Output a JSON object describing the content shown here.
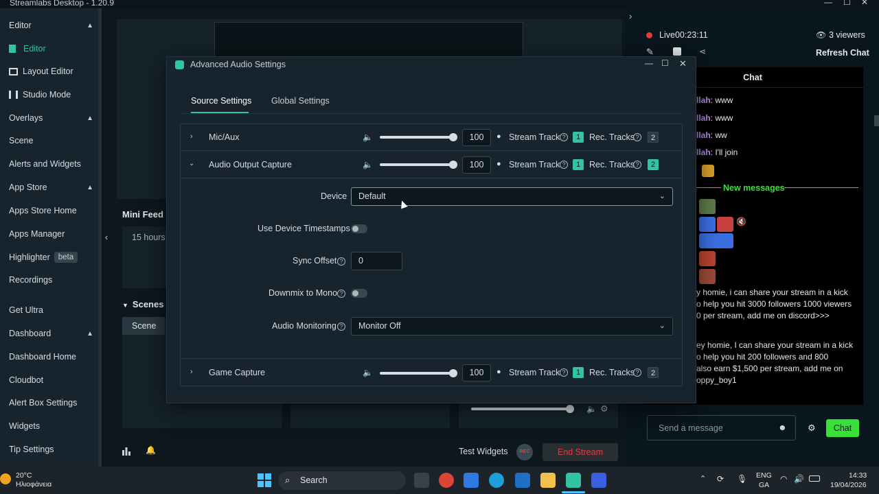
{
  "app": {
    "title": "Streamlabs Desktop - 1.20.9"
  },
  "sidebar": {
    "items": [
      {
        "label": "Editor",
        "kind": "head"
      },
      {
        "label": "Editor",
        "kind": "sub",
        "active": true
      },
      {
        "label": "Layout Editor",
        "kind": "sub"
      },
      {
        "label": "Studio Mode",
        "kind": "sub"
      },
      {
        "label": "Overlays",
        "kind": "head"
      },
      {
        "label": "Scene",
        "kind": "sub"
      },
      {
        "label": "Alerts and Widgets",
        "kind": "sub"
      },
      {
        "label": "App Store",
        "kind": "head"
      },
      {
        "label": "Apps Store Home",
        "kind": "sub"
      },
      {
        "label": "Apps Manager",
        "kind": "sub"
      },
      {
        "label": "Highlighter",
        "kind": "head",
        "badge": "beta"
      },
      {
        "label": "Recordings",
        "kind": "sub"
      },
      {
        "label": "Get Ultra",
        "kind": "head"
      },
      {
        "label": "Dashboard",
        "kind": "head"
      },
      {
        "label": "Dashboard Home",
        "kind": "sub"
      },
      {
        "label": "Cloudbot",
        "kind": "sub"
      },
      {
        "label": "Alert Box Settings",
        "kind": "sub"
      },
      {
        "label": "Widgets",
        "kind": "sub"
      },
      {
        "label": "Tip Settings",
        "kind": "sub"
      }
    ]
  },
  "main": {
    "mini_feed": "Mini Feed",
    "mini_feed_time": "15 hours",
    "scenes": "Scenes",
    "scene_item": "Scene",
    "test_widgets": "Test Widgets",
    "rec": "REC",
    "end_stream": "End Stream"
  },
  "chat": {
    "live": "Live",
    "timer": "00:23:11",
    "viewers": "3 viewers",
    "refresh": "Refresh Chat",
    "title": "Chat",
    "lines": [
      {
        "user": "llah",
        "text": ": www"
      },
      {
        "user": "llah",
        "text": ": www"
      },
      {
        "user": "llah",
        "text": ": ww"
      },
      {
        "user": "llah",
        "text": ": I'll join"
      }
    ],
    "new_messages": "New messages",
    "spam1": [
      "y homie, i can share your stream in a kick",
      "o help you hit 3000 followers 1000 viewers",
      "0 per stream, add me on discord>>>"
    ],
    "spam2": [
      "ey homie, I can share your stream in a kick",
      "o help you hit 200 followers and 800",
      "also earn $1,500 per stream, add me on",
      "oppy_boy1"
    ],
    "input_placeholder": "Send a message",
    "send": "Chat"
  },
  "dialog": {
    "title": "Advanced Audio Settings",
    "tabs": [
      "Source Settings",
      "Global Settings"
    ],
    "sources": [
      {
        "name": "Mic/Aux",
        "volume": "100",
        "level": 0.97,
        "stream_track": "Stream Track",
        "stream_badge": "1",
        "rec_tracks": "Rec. Tracks",
        "rec_badge": "2",
        "rec_on": false
      },
      {
        "name": "Audio Output Capture",
        "volume": "100",
        "level": 0.97,
        "stream_track": "Stream Track",
        "stream_badge": "1",
        "rec_tracks": "Rec. Tracks",
        "rec_badge": "2",
        "rec_on": true
      },
      {
        "name": "Game Capture",
        "volume": "100",
        "level": 0.97,
        "stream_track": "Stream Track",
        "stream_badge": "1",
        "rec_tracks": "Rec. Tracks",
        "rec_badge": "2",
        "rec_on": false
      }
    ],
    "device_label": "Device",
    "device_value": "Default",
    "timestamps_label": "Use Device Timestamps",
    "sync_label": "Sync Offset",
    "sync_value": "0",
    "downmix_label": "Downmix to Mono",
    "monitoring_label": "Audio Monitoring",
    "monitoring_value": "Monitor Off"
  },
  "taskbar": {
    "temp": "20°C",
    "weather": "Ηλιοφάνεια",
    "search": "Search",
    "lang1": "ENG",
    "lang2": "GA",
    "time": "14:33",
    "date": "19/04/2026"
  },
  "colors": {
    "accent": "#31c3a2",
    "end_stream": "#e43c3c",
    "chat_green": "#39e039"
  }
}
